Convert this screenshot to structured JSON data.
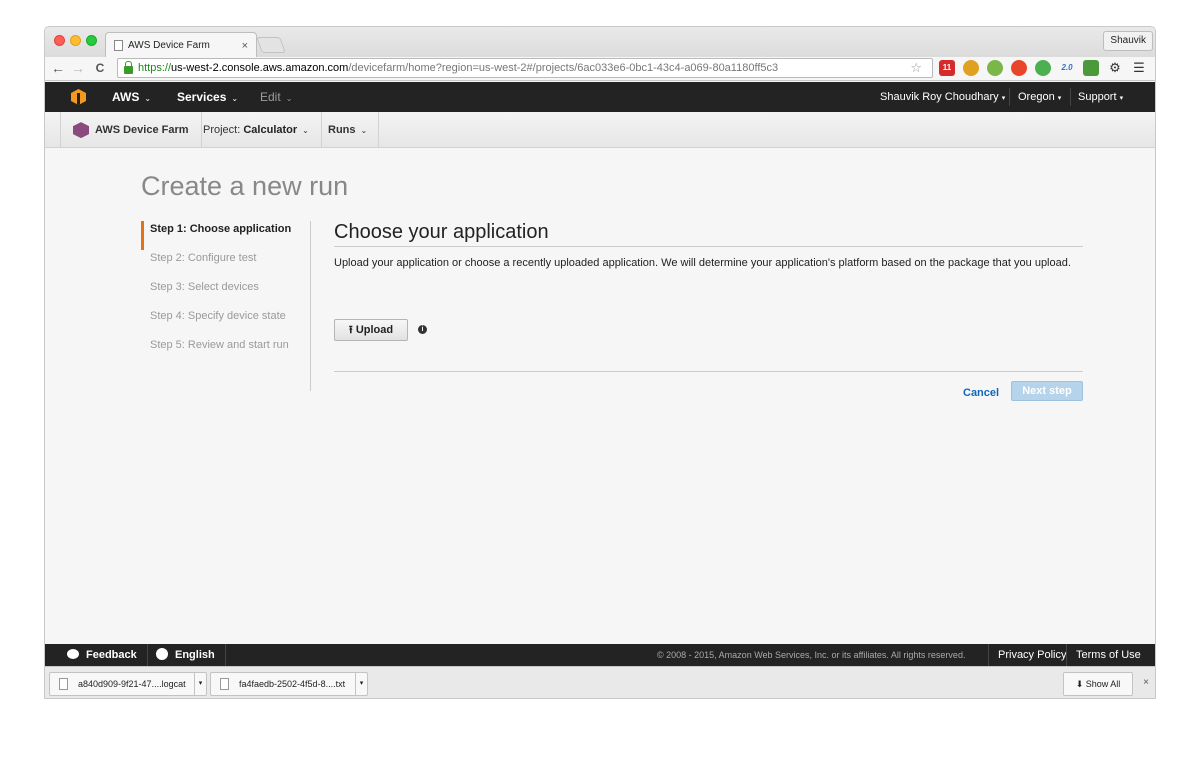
{
  "browser": {
    "tab_title": "AWS Device Farm",
    "tab_close": "×",
    "profile_name": "Shauvik",
    "url_scheme": "https://",
    "url_host": "us-west-2.console.aws.amazon.com",
    "url_path": "/devicefarm/home?region=us-west-2#/projects/6ac033e6-0bc1-43c4-a069-80a1180ff5c3",
    "back": "←",
    "forward": "→",
    "reload": "C",
    "star": "☆",
    "menu": "☰",
    "extension_badge": "11",
    "extension_text": "2.0"
  },
  "aws_header": {
    "aws_label": "AWS",
    "services_label": "Services",
    "edit_label": "Edit",
    "user_label": "Shauvik Roy Choudhary",
    "region_label": "Oregon",
    "support_label": "Support",
    "caret": "⌄"
  },
  "subnav": {
    "service_name": "AWS Device Farm",
    "project_prefix": "Project: ",
    "project_name": "Calculator",
    "runs_label": "Runs",
    "caret": "⌄"
  },
  "page": {
    "title": "Create a new run",
    "steps": [
      {
        "label": "Step 1: Choose application",
        "active": true
      },
      {
        "label": "Step 2: Configure test",
        "active": false
      },
      {
        "label": "Step 3: Select devices",
        "active": false
      },
      {
        "label": "Step 4: Specify device state",
        "active": false
      },
      {
        "label": "Step 5: Review and start run",
        "active": false
      }
    ],
    "section_heading": "Choose your application",
    "description": "Upload your application or choose a recently uploaded application. We will determine your application's platform based on the package that you upload.",
    "upload_label": "Upload",
    "upload_icon": "⭱",
    "info_icon": "i",
    "cancel_label": "Cancel",
    "next_label": "Next step"
  },
  "footer": {
    "feedback_label": "Feedback",
    "language_label": "English",
    "copyright": "© 2008 - 2015, Amazon Web Services, Inc. or its affiliates. All rights reserved.",
    "privacy_label": "Privacy Policy",
    "terms_label": "Terms of Use"
  },
  "downloads": {
    "items": [
      {
        "name": "a840d909-9f21-47....logcat"
      },
      {
        "name": "fa4faedb-2502-4f5d-8....txt"
      }
    ],
    "show_all_label": "Show All",
    "show_all_icon": "⬇",
    "dropdown": "▾",
    "close": "×"
  },
  "colors": {
    "accent_orange": "#e17218",
    "aws_bar": "#232323",
    "link_blue": "#1166bb",
    "disabled_button": "#b5d3ea"
  }
}
